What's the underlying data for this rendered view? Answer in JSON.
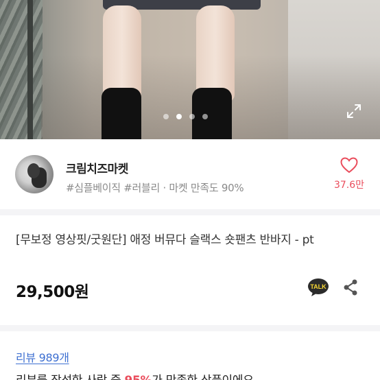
{
  "gallery": {
    "image_count": 4,
    "active_index": 1,
    "expand_icon": "expand-icon"
  },
  "seller": {
    "name": "크림치즈마켓",
    "tags": "#심플베이직 #러블리",
    "separator": "·",
    "satisfaction": "마켓 만족도 90%",
    "like_icon": "heart-icon",
    "like_count": "37.6만"
  },
  "product": {
    "title": "[무보정 영상핏/굿원단] 애정 버뮤다 슬랙스 숏팬츠 반바지 - pt",
    "price": "29,500원",
    "talk_label": "TALK",
    "share_icon": "share-icon"
  },
  "review": {
    "link_label": "리뷰 989개",
    "summary_prefix": "리뷰를 작성한 사람 중 ",
    "summary_highlight": "95%",
    "summary_suffix": "가 만족한 상품이에요"
  },
  "colors": {
    "accent_red": "#ea4d5c",
    "link_blue": "#3d6fd1",
    "kakao_talk": "#2b2b2b"
  }
}
